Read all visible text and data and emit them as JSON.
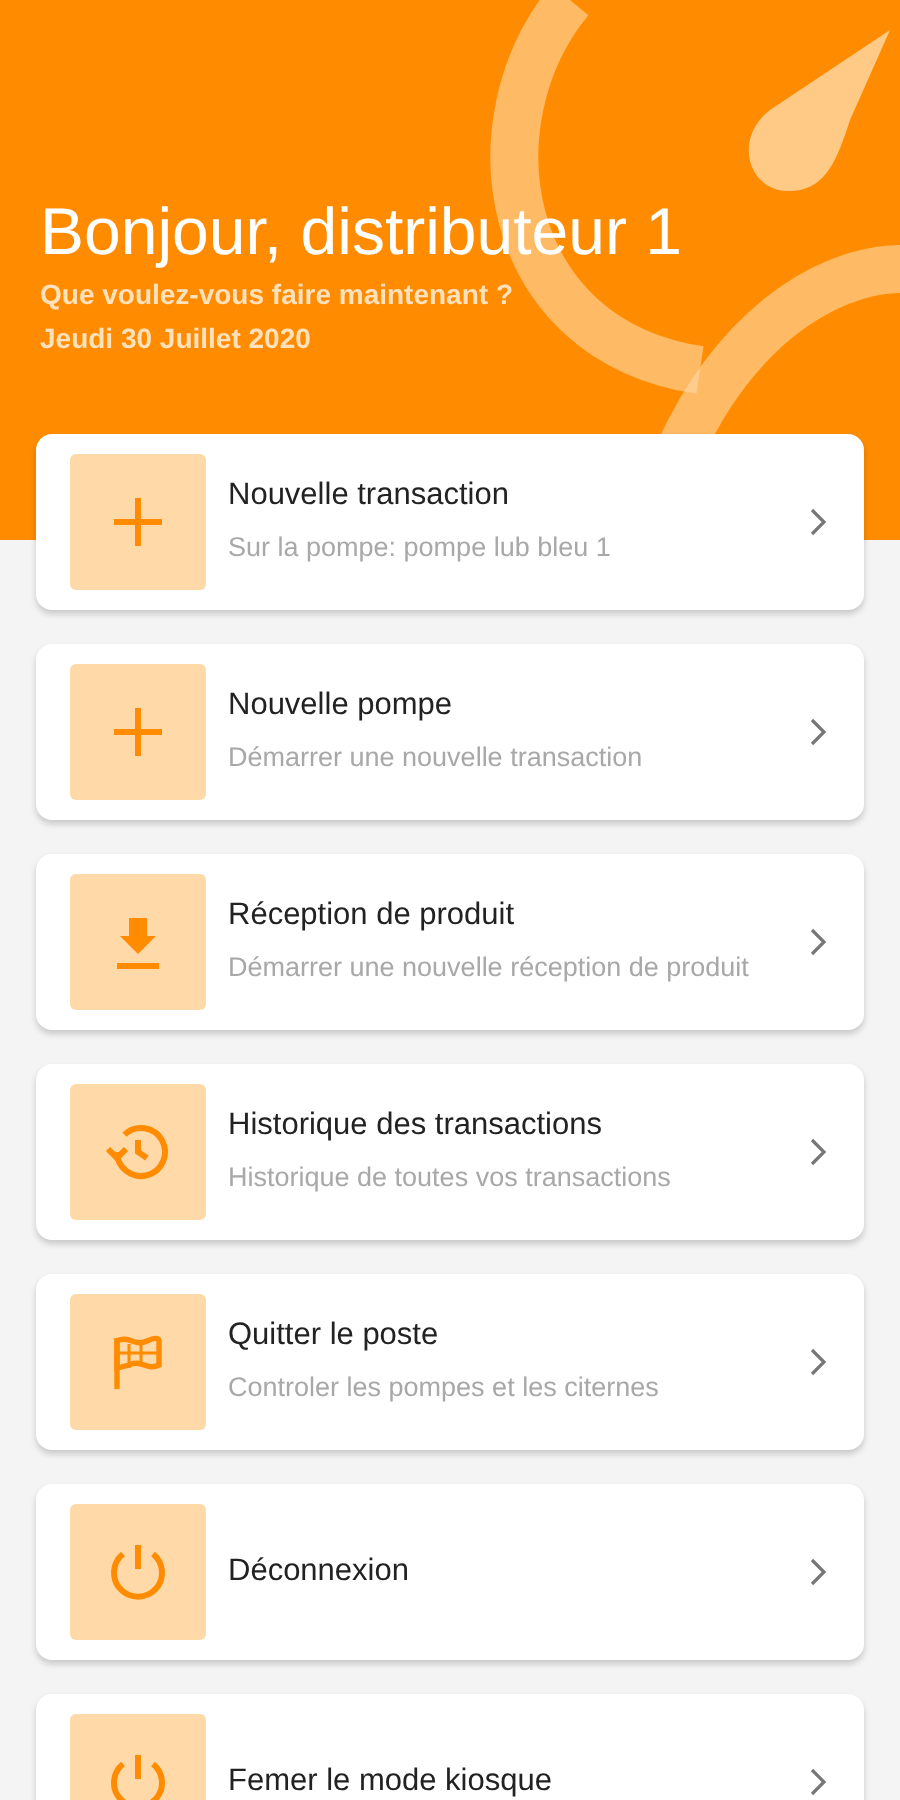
{
  "header": {
    "greeting": "Bonjour, distributeur 1",
    "prompt": "Que voulez-vous faire maintenant ?",
    "date": "Jeudi 30 Juillet 2020"
  },
  "actions": [
    {
      "kind": "plus",
      "title": "Nouvelle transaction",
      "subtitle": "Sur la pompe: pompe lub bleu 1"
    },
    {
      "kind": "plus",
      "title": "Nouvelle pompe",
      "subtitle": "Démarrer une nouvelle transaction"
    },
    {
      "kind": "download",
      "title": "Réception de produit",
      "subtitle": "Démarrer une nouvelle réception de produit"
    },
    {
      "kind": "history",
      "title": "Historique des transactions",
      "subtitle": "Historique de toutes vos transactions"
    },
    {
      "kind": "flag",
      "title": "Quitter le poste",
      "subtitle": "Controler les pompes et les citernes"
    },
    {
      "kind": "power",
      "title": "Déconnexion"
    },
    {
      "kind": "power",
      "title": "Femer le mode kiosque"
    }
  ]
}
